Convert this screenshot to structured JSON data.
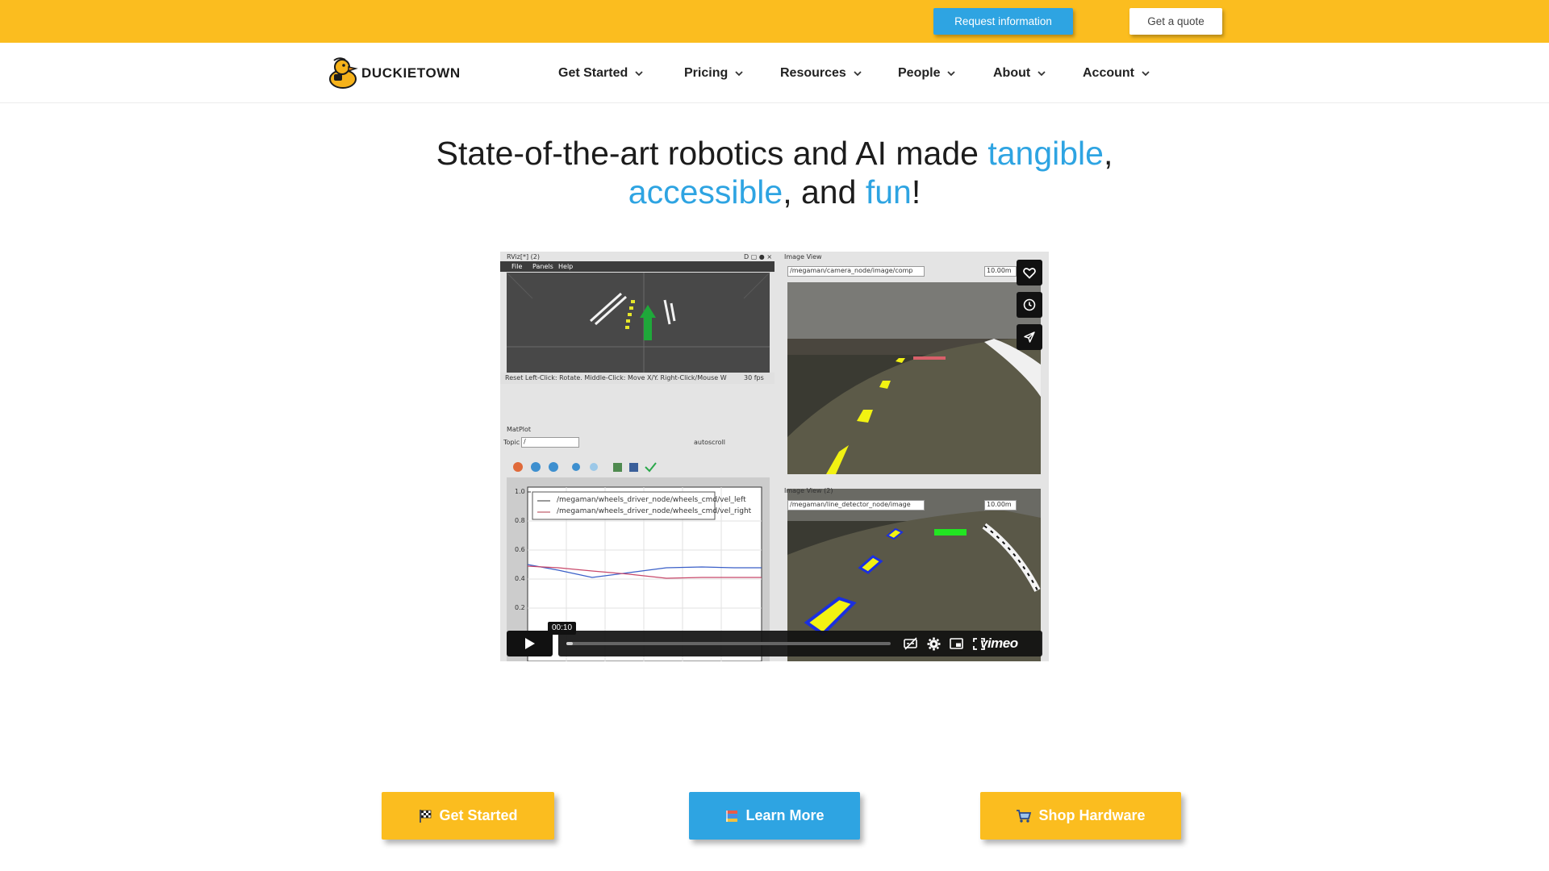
{
  "topbar": {
    "request_label": "Request information",
    "quote_label": "Get a quote",
    "background_color": "#fbbd1f",
    "accent_color": "#2ea4e2"
  },
  "logo": {
    "text": "DUCKIETOWN",
    "icon": "duck-icon"
  },
  "nav": {
    "items": [
      {
        "label": "Get Started",
        "icon": "chevron-down-icon"
      },
      {
        "label": "Pricing",
        "icon": "chevron-down-icon"
      },
      {
        "label": "Resources",
        "icon": "chevron-down-icon"
      },
      {
        "label": "People",
        "icon": "chevron-down-icon"
      },
      {
        "label": "About",
        "icon": "chevron-down-icon"
      },
      {
        "label": "Account",
        "icon": "chevron-down-icon"
      }
    ]
  },
  "hero": {
    "part1": "State-of-the-art robotics and AI made ",
    "accent1": "tangible",
    "part2": ",",
    "accent2": "accessible",
    "part3": ", and ",
    "accent3": "fun",
    "part4": "!"
  },
  "video": {
    "timecode": "00:10",
    "progress_fraction": 0.02,
    "brand": "vimeo",
    "side_icons": [
      "heart-icon",
      "clock-icon",
      "send-icon"
    ],
    "control_icons": [
      "play-icon",
      "captions-off-icon",
      "settings-icon",
      "pip-icon",
      "fullscreen-icon"
    ],
    "frame": {
      "rviz_title": "RViz[*] (2)",
      "rviz_menu": [
        "File",
        "Panels",
        "Help"
      ],
      "rviz_status": "Reset   Left-Click: Rotate. Middle-Click: Move X/Y. Right-Click/Mouse W",
      "rviz_fps": "30 fps",
      "matplot_title": "MatPlot",
      "matplot_topic_label": "Topic",
      "matplot_topic_value": "/",
      "matplot_autoscroll": "autoscroll",
      "legend": [
        "/megaman/wheels_driver_node/wheels_cmd/vel_left",
        "/megaman/wheels_driver_node/wheels_cmd/vel_right"
      ],
      "y_ticks": [
        "1.0",
        "0.8",
        "0.6",
        "0.4",
        "0.2"
      ],
      "image_view_title": "Image View",
      "image_view_topic": "/megaman/camera_node/image/comp",
      "image_view_rate": "10.00m",
      "image_view2_title": "Image View (2)",
      "image_view2_topic": "/megaman/line_detector_node/image",
      "image_view2_rate": "10.00m"
    }
  },
  "cta": {
    "start_label": "Get Started",
    "start_icon": "checkered-flag-icon",
    "learn_label": "Learn More",
    "learn_icon": "books-icon",
    "shop_label": "Shop Hardware",
    "shop_icon": "shopping-cart-icon"
  }
}
